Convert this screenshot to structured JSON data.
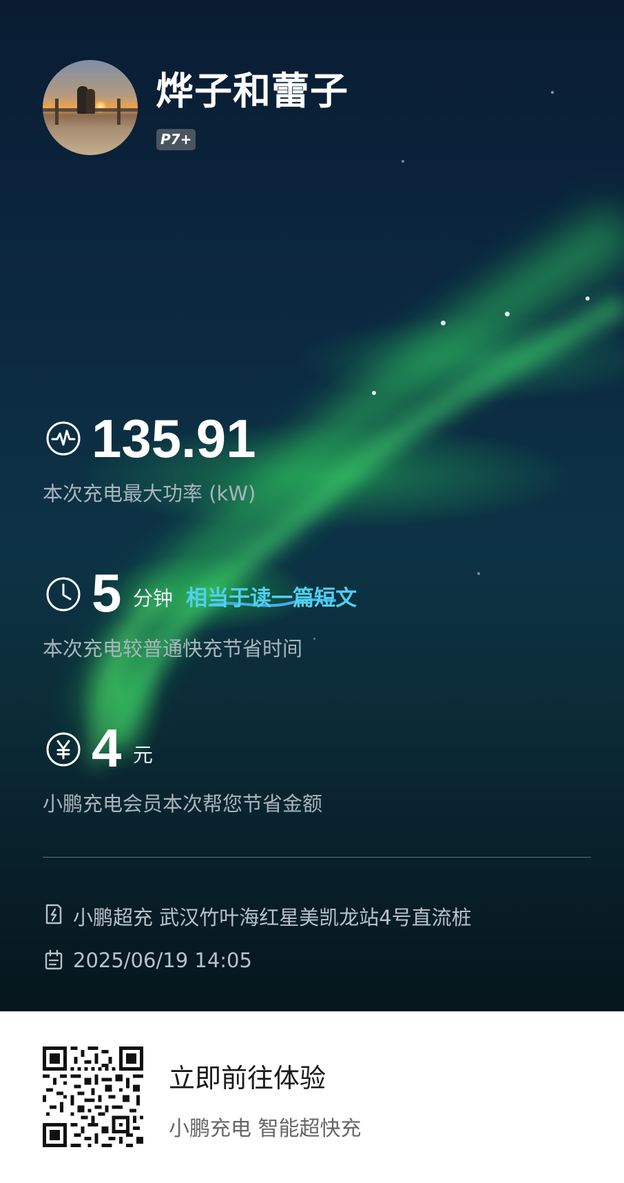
{
  "profile": {
    "username": "烨子和蕾子",
    "badge": "P7+"
  },
  "stats": {
    "max_power": {
      "value": "135.91",
      "caption": "本次充电最大功率 (kW)",
      "icon": "power-pulse-icon"
    },
    "time_saved": {
      "value": "5",
      "unit": "分钟",
      "comparison": "相当于读一篇短文",
      "caption": "本次充电较普通快充节省时间",
      "icon": "clock-icon"
    },
    "money_saved": {
      "value": "4",
      "unit": "元",
      "caption": "小鹏充电会员本次帮您节省金额",
      "icon": "yuan-icon"
    }
  },
  "session": {
    "station": "小鹏超充 武汉竹叶海红星美凯龙站4号直流桩",
    "datetime": "2025/06/19 14:05"
  },
  "footer": {
    "cta_title": "立即前往体验",
    "cta_subtitle": "小鹏充电 智能超快充"
  },
  "colors": {
    "highlight": "#4fd1ef",
    "caption": "#a9b5bd"
  }
}
